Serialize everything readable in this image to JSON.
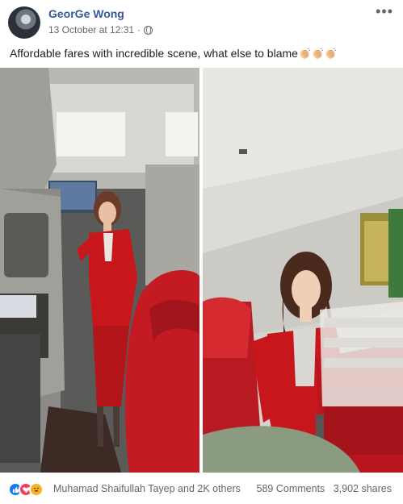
{
  "post": {
    "author": "GeorGe Wong",
    "date": "13 October at 12:31",
    "privacy_separator": "·",
    "privacy_icon": "globe-icon",
    "more_label": "•••",
    "caption": "Affordable fares with incredible scene, what else to blame"
  },
  "footer": {
    "reactions": [
      "like",
      "love",
      "haha"
    ],
    "reactors": "Muhamad Shaifullah Tayep and 2K others",
    "comments": "589 Comments",
    "shares": "3,902 shares"
  },
  "colors": {
    "link": "#385898",
    "like": "#1877f2",
    "love": "#f33e58",
    "haha": "#f7b125",
    "uniform": "#c8171c"
  }
}
